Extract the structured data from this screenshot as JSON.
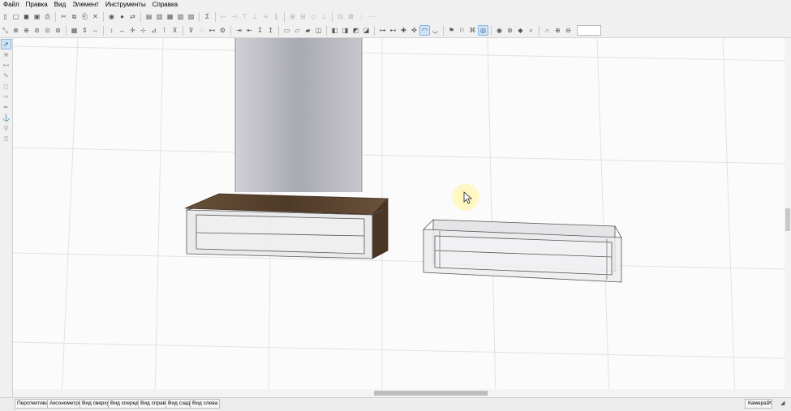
{
  "menu": [
    "Файл",
    "Правка",
    "Вид",
    "Элемент",
    "Инструменты",
    "Справка"
  ],
  "toolbar1": [
    "▯",
    "▢",
    "◼",
    "▣",
    "⎙",
    "✂",
    "⧉",
    "⎗",
    "✕",
    "◉",
    "●",
    "⇄",
    "▤",
    "▥",
    "▦",
    "▧",
    "▨",
    "Σ",
    "⊢",
    "⊣",
    "⊤",
    "⊥",
    "≡",
    "∥",
    "⊞",
    "⊟",
    "◇",
    "⟂",
    "⊡",
    "⊠",
    "⋮",
    "⋯"
  ],
  "toolbar2": [
    "⤡",
    "⊗",
    "⊕",
    "⊘",
    "⊙",
    "⊚",
    "▦",
    "⇕",
    "⇔",
    "↕",
    "↔",
    "✛",
    "⊹",
    "⊿",
    "⊺",
    "⊼",
    "⊽",
    "◌",
    "⊷",
    "⚙",
    "⇥",
    "⇤",
    "↧",
    "↥",
    "▭",
    "▱",
    "▰",
    "◫",
    "◧",
    "◨",
    "◩",
    "◪",
    "⊶",
    "⊷",
    "✚",
    "✜",
    "◠",
    "◡",
    "⚑",
    "⚐",
    "⌘",
    "◎",
    "◉",
    "⊛",
    "◆",
    "⌕",
    "∩",
    "⊕",
    "⊖"
  ],
  "zoom": {
    "value": ""
  },
  "lefttools": [
    "➚",
    "⋇",
    "⊷",
    "✎",
    "◻",
    "✑",
    "✒",
    "⚓",
    "⚲",
    "⍰"
  ],
  "tabs": [
    "Перспектива",
    "Аксонометрия",
    "Вид сверху",
    "Вид спереди",
    "Вид справа",
    "Вид сзади",
    "Вид слева"
  ],
  "camera": {
    "label": "Камера1",
    "close": "✕"
  },
  "colors": {
    "wood": "#5d4632",
    "woodDark": "#3f2d1f",
    "panel": "#bfbfc6",
    "drawerFill": "#e8e8ea",
    "edge": "#555555",
    "grid": "#e1e1e1",
    "cursor": "#fff3a8"
  }
}
